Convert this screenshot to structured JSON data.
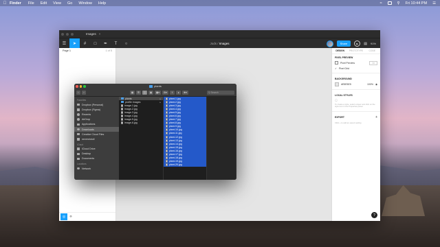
{
  "menubar": {
    "apple": "",
    "app_name": "Finder",
    "items": [
      "File",
      "Edit",
      "View",
      "Go",
      "Window",
      "Help"
    ],
    "clock": "Fri 10:44 PM"
  },
  "figma": {
    "tab_title": "Images",
    "tab_close": "×",
    "breadcrumb_project": "Jods",
    "breadcrumb_sep": "/",
    "breadcrumb_file": "Images",
    "share_label": "Share",
    "zoom_label": "91%",
    "page_name": "Page 1",
    "page_count": "1 of 5",
    "props_tabs": [
      "DESIGN",
      "PROTOTYPE",
      "CODE"
    ],
    "pixel_preview_title": "PIXEL PREVIEW",
    "pixel_preview_label": "Pixel Preview",
    "pixel_preview_value": "1x",
    "pixel_grid_label": "Pixel Grid",
    "background_title": "BACKGROUND",
    "background_hex": "#E5E5E5",
    "background_opacity": "100%",
    "local_styles_title": "LOCAL STYLES",
    "local_styles_hint": "To create a style, select a layer and click on the style icon in the Properties panel.",
    "export_title": "EXPORT",
    "export_hint": "Click + to add an export setting",
    "help": "?"
  },
  "finder": {
    "title": "plants",
    "search_placeholder": "Search",
    "sidebar": {
      "favorites_head": "Favorites",
      "favorites": [
        "Dropbox (Personal)",
        "Dropbox (Figma)",
        "Recents",
        "AirDrop",
        "Applications",
        "Downloads",
        "Creative Cloud Files",
        "nevershdull"
      ],
      "icloud_head": "iCloud",
      "icloud": [
        "iCloud Drive",
        "Desktop",
        "Documents"
      ],
      "locations_head": "Locations",
      "locations": [
        "Network"
      ]
    },
    "col1": [
      "plants",
      "profile images",
      "image-1.jpg",
      "image-2.jpg",
      "image-3.jpg",
      "image-4.jpg",
      "image-5.jpg",
      "image-6.jpg"
    ],
    "col2": [
      "plant-1.jpg",
      "plant-2.jpg",
      "plant-3.jpg",
      "plant-4.jpg",
      "plant-5.jpg",
      "plant-6.jpg",
      "plant-7.jpg",
      "plant-8.jpg",
      "plant-9.jpg",
      "plant-10.jpg",
      "plant-11.jpg",
      "plant-12.jpg",
      "plant-13.jpg",
      "plant-14.jpg",
      "plant-15.jpg",
      "plant-16.jpg",
      "plant-17.jpg",
      "plant-18.jpg",
      "plant-19.jpg",
      "plant-20.jpg"
    ]
  }
}
